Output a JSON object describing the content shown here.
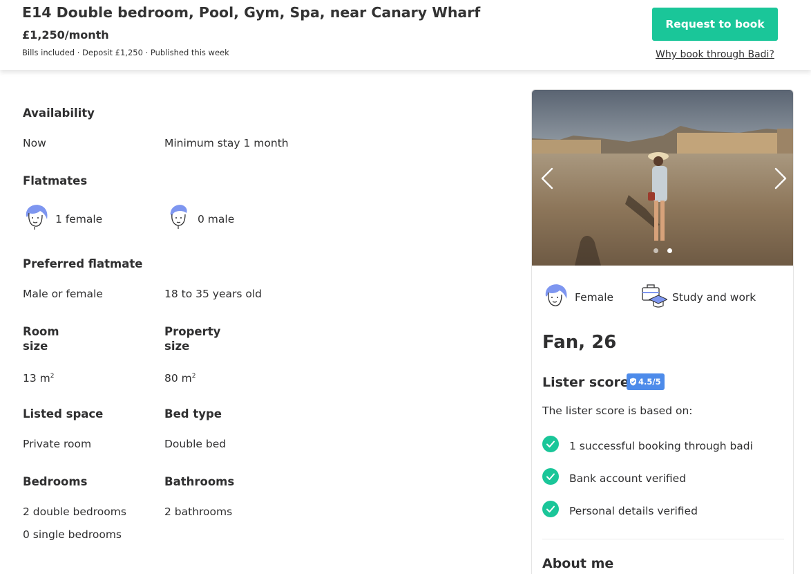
{
  "header": {
    "title": "E14 Double bedroom, Pool, Gym, Spa, near Canary Wharf",
    "price": "£1,250/month",
    "meta": "Bills included · Deposit £1,250 · Published this week",
    "book_button": "Request to book",
    "why_link": "Why book through Badi?"
  },
  "details": {
    "availability": {
      "heading": "Availability",
      "from": "Now",
      "min_stay": "Minimum stay 1 month"
    },
    "flatmates": {
      "heading": "Flatmates",
      "female": "1 female",
      "male": "0 male"
    },
    "preferred": {
      "heading": "Preferred flatmate",
      "gender": "Male or female",
      "age": "18 to 35 years old"
    },
    "room_size": {
      "heading": "Room size",
      "value": "13 m",
      "unit_sup": "2"
    },
    "property_size": {
      "heading": "Property size",
      "value": "80 m",
      "unit_sup": "2"
    },
    "listed_space": {
      "heading": "Listed space",
      "value": "Private room"
    },
    "bed_type": {
      "heading": "Bed type",
      "value": "Double bed"
    },
    "bedrooms": {
      "heading": "Bedrooms",
      "double": "2 double bedrooms",
      "single": "0 single bedrooms"
    },
    "bathrooms": {
      "heading": "Bathrooms",
      "value": "2 bathrooms"
    }
  },
  "lister": {
    "photo_dots": {
      "count": 2,
      "active_index": 1
    },
    "gender": "Female",
    "occupation": "Study and work",
    "name": "Fan, 26",
    "score_heading": "Lister score",
    "score_badge": "4.5/5",
    "score_intro": "The lister score is based on:",
    "checks": [
      "1 successful booking through badi",
      "Bank account verified",
      "Personal details verified"
    ],
    "about_heading": "About me"
  },
  "colors": {
    "accent_green": "#1ac699",
    "badge_blue": "#4d8bea",
    "icon_blue": "#6f8ff0"
  }
}
